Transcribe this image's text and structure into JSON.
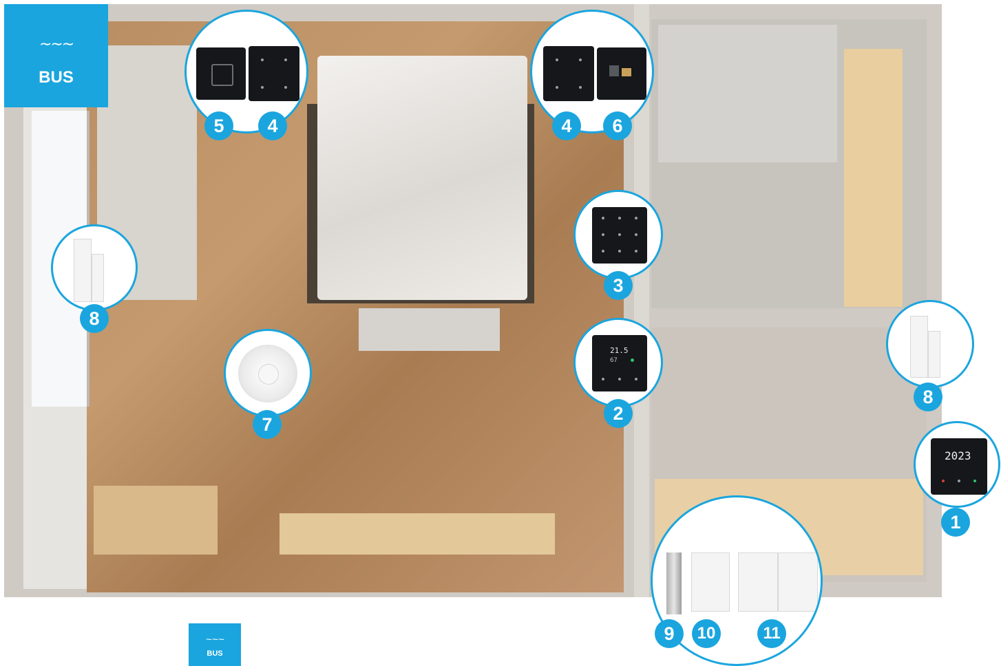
{
  "logo": {
    "wave": "∼∼∼",
    "label": "BUS"
  },
  "logo_small": {
    "wave": "∼∼∼",
    "label": "BUS"
  },
  "calendar_display": {
    "text": "2023"
  },
  "thermostat_display": {
    "temp": "21.5",
    "humidity": "67"
  },
  "callouts": [
    {
      "id": "5",
      "label": "5"
    },
    {
      "id": "4a",
      "label": "4"
    },
    {
      "id": "4b",
      "label": "4"
    },
    {
      "id": "6",
      "label": "6"
    },
    {
      "id": "3",
      "label": "3"
    },
    {
      "id": "2",
      "label": "2"
    },
    {
      "id": "7",
      "label": "7"
    },
    {
      "id": "8a",
      "label": "8"
    },
    {
      "id": "8b",
      "label": "8"
    },
    {
      "id": "1",
      "label": "1"
    },
    {
      "id": "9",
      "label": "9"
    },
    {
      "id": "10",
      "label": "10"
    },
    {
      "id": "11",
      "label": "11"
    }
  ],
  "colors": {
    "accent": "#1aa5de",
    "panel": "#15171a"
  }
}
